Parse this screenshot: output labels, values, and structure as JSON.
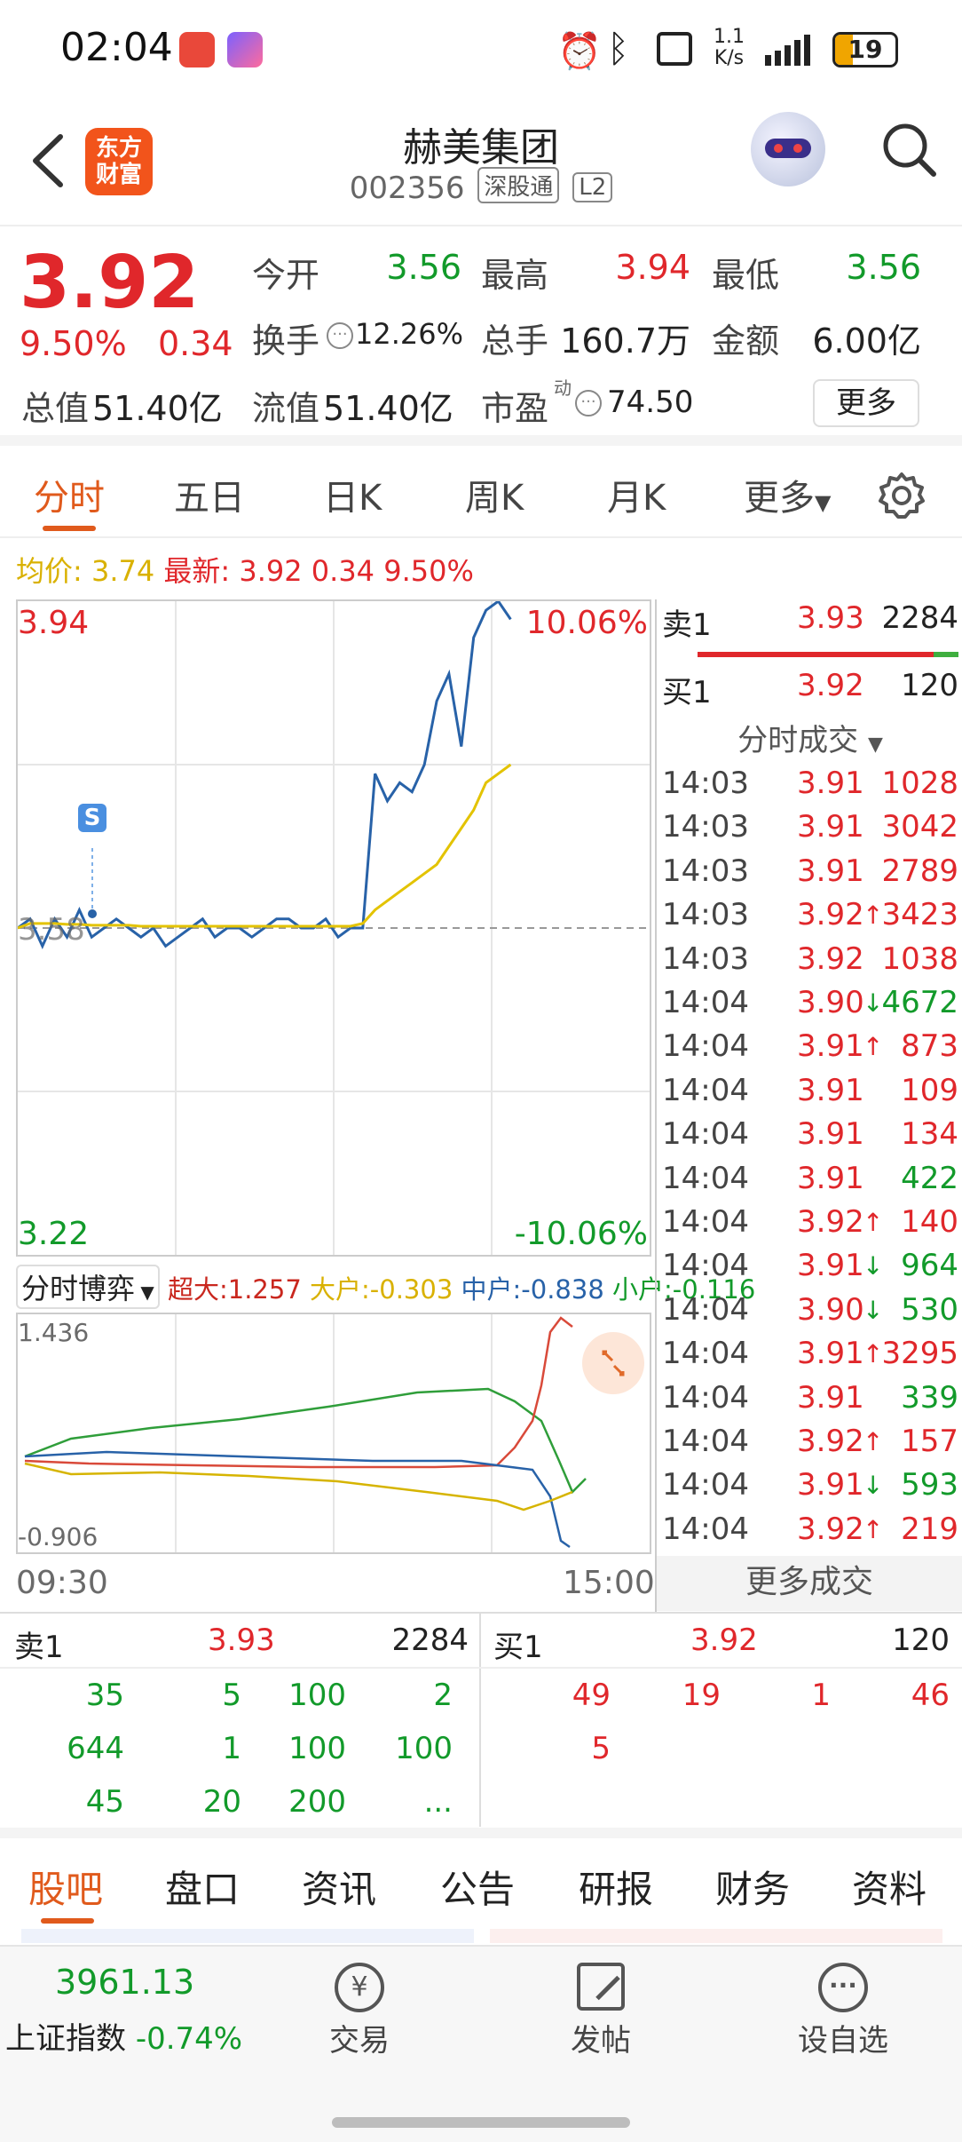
{
  "status_bar": {
    "time": "02:04",
    "net_speed_top": "1.1",
    "net_speed_bottom": "K/s",
    "battery": "19"
  },
  "header": {
    "logo_line1": "东方",
    "logo_line2": "财富",
    "title": "赫美集团",
    "code": "002356",
    "tag1": "深股通",
    "tag2": "L2"
  },
  "quote": {
    "price": "3.92",
    "change_pct": "9.50%",
    "change": "0.34",
    "open_label": "今开",
    "open": "3.56",
    "high_label": "最高",
    "high": "3.94",
    "low_label": "最低",
    "low": "3.56",
    "turnover_label": "换手",
    "turnover": "12.26%",
    "volume_label": "总手",
    "volume": "160.7万",
    "amount_label": "金额",
    "amount": "6.00亿",
    "mktcap_label": "总值",
    "mktcap": "51.40亿",
    "float_label": "流值",
    "float": "51.40亿",
    "pe_label": "市盈",
    "pe_sup": "动",
    "pe": "74.50",
    "more_button": "更多"
  },
  "tabs": [
    "分时",
    "五日",
    "日K",
    "周K",
    "月K",
    "更多"
  ],
  "chart_header": {
    "avg_label": "均价:",
    "avg": "3.74",
    "latest_label": "最新:",
    "latest": "3.92",
    "chg": "0.34",
    "pct": "9.50%"
  },
  "chart_data": [
    {
      "type": "line",
      "y_top_label": "3.94",
      "y_bottom_label": "3.22",
      "y_mid_label": "3.58",
      "pct_top_label": "10.06%",
      "pct_bottom_label": "-10.06%",
      "ylim": [
        3.22,
        3.94
      ],
      "series": [
        {
          "color": "#2862a8",
          "values": [
            3.58,
            3.59,
            3.56,
            3.59,
            3.57,
            3.6,
            3.57,
            3.58,
            3.59,
            3.58,
            3.57,
            3.58,
            3.56,
            3.57,
            3.58,
            3.59,
            3.57,
            3.58,
            3.58,
            3.57,
            3.58,
            3.59,
            3.59,
            3.58,
            3.58,
            3.59,
            3.57,
            3.58,
            3.58,
            3.75,
            3.72,
            3.74,
            3.73,
            3.76,
            3.83,
            3.86,
            3.78,
            3.9,
            3.93,
            3.94,
            3.92
          ]
        },
        {
          "color": "#e3c300",
          "values": [
            3.58,
            3.585,
            3.585,
            3.585,
            3.584,
            3.584,
            3.583,
            3.583,
            3.583,
            3.583,
            3.582,
            3.582,
            3.582,
            3.582,
            3.582,
            3.582,
            3.582,
            3.582,
            3.582,
            3.582,
            3.582,
            3.582,
            3.582,
            3.582,
            3.582,
            3.582,
            3.582,
            3.582,
            3.585,
            3.6,
            3.61,
            3.62,
            3.63,
            3.64,
            3.65,
            3.67,
            3.69,
            3.71,
            3.74,
            3.75,
            3.76
          ]
        }
      ],
      "annotation": "S"
    },
    {
      "type": "line",
      "y_top_label": "1.436",
      "y_bottom_label": "-0.906",
      "x_start": "09:30",
      "x_end": "15:00",
      "ylim": [
        -0.906,
        1.436
      ]
    }
  ],
  "flow": {
    "title": "分时博弈",
    "super_label": "超大:",
    "super": "1.257",
    "large_label": "大户:",
    "large": "-0.303",
    "mid_label": "中户:",
    "mid": "-0.838",
    "small_label": "小户:",
    "small": "-0.116"
  },
  "orderbook": {
    "sell1_label": "卖1",
    "sell1_price": "3.93",
    "sell1_vol": "2284",
    "buy1_label": "买1",
    "buy1_price": "3.92",
    "buy1_vol": "120",
    "trades_title": "分时成交",
    "more_trades": "更多成交",
    "trades": [
      {
        "t": "14:03",
        "p": "3.91",
        "a": "",
        "v": "1028",
        "c": "red"
      },
      {
        "t": "14:03",
        "p": "3.91",
        "a": "",
        "v": "3042",
        "c": "red"
      },
      {
        "t": "14:03",
        "p": "3.91",
        "a": "",
        "v": "2789",
        "c": "red"
      },
      {
        "t": "14:03",
        "p": "3.92",
        "a": "↑",
        "v": "3423",
        "c": "red"
      },
      {
        "t": "14:03",
        "p": "3.92",
        "a": "",
        "v": "1038",
        "c": "red"
      },
      {
        "t": "14:04",
        "p": "3.90",
        "a": "↓",
        "v": "4672",
        "c": "green"
      },
      {
        "t": "14:04",
        "p": "3.91",
        "a": "↑",
        "v": "873",
        "c": "red"
      },
      {
        "t": "14:04",
        "p": "3.91",
        "a": "",
        "v": "109",
        "c": "red"
      },
      {
        "t": "14:04",
        "p": "3.91",
        "a": "",
        "v": "134",
        "c": "red"
      },
      {
        "t": "14:04",
        "p": "3.91",
        "a": "",
        "v": "422",
        "c": "green"
      },
      {
        "t": "14:04",
        "p": "3.92",
        "a": "↑",
        "v": "140",
        "c": "red"
      },
      {
        "t": "14:04",
        "p": "3.91",
        "a": "↓",
        "v": "964",
        "c": "green"
      },
      {
        "t": "14:04",
        "p": "3.90",
        "a": "↓",
        "v": "530",
        "c": "green"
      },
      {
        "t": "14:04",
        "p": "3.91",
        "a": "↑",
        "v": "3295",
        "c": "red"
      },
      {
        "t": "14:04",
        "p": "3.91",
        "a": "",
        "v": "339",
        "c": "green"
      },
      {
        "t": "14:04",
        "p": "3.92",
        "a": "↑",
        "v": "157",
        "c": "red"
      },
      {
        "t": "14:04",
        "p": "3.91",
        "a": "↓",
        "v": "593",
        "c": "green"
      },
      {
        "t": "14:04",
        "p": "3.92",
        "a": "↑",
        "v": "219",
        "c": "red"
      }
    ]
  },
  "depth": {
    "sell_label": "卖1",
    "sell_price": "3.93",
    "sell_vol": "2284",
    "buy_label": "买1",
    "buy_price": "3.92",
    "buy_vol": "120",
    "sell_queue": [
      [
        "35",
        "5",
        "100",
        "2"
      ],
      [
        "644",
        "1",
        "100",
        "100"
      ],
      [
        "45",
        "20",
        "200",
        "..."
      ]
    ],
    "buy_queue": [
      [
        "49",
        "19",
        "1",
        "46"
      ],
      [
        "5",
        "",
        "",
        ""
      ]
    ]
  },
  "bottom_tabs": [
    "股吧",
    "盘口",
    "资讯",
    "公告",
    "研报",
    "财务",
    "资料"
  ],
  "nav": {
    "index_value": "3961.13",
    "index_name": "上证指数",
    "index_change": "-0.74%",
    "trade": "交易",
    "post": "发帖",
    "watchlist": "设自选"
  }
}
